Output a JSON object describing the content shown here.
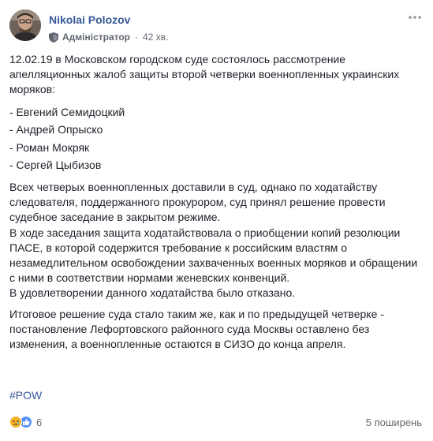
{
  "post": {
    "author_name": "Nikolai Polozov",
    "role": "Адміністратор",
    "time_ago": "42 хв.",
    "paragraphs": [
      "12.02.19 в Московском городском суде состоялось рассмотрение апелляционных жалоб защиты второй четверки военнопленных украинских моряков:"
    ],
    "list": [
      "- Евгений Семидоцкий",
      "- Андрей Опрыско",
      "- Роман Мокряк",
      "- Сергей Цыбизов"
    ],
    "paragraph_2": "Всех четверых военнопленных доставили в суд, однако по ходатайству следователя, поддержанного прокурором, суд принял решение провести судебное заседание в закрытом режиме.",
    "paragraph_3": "В ходе заседания защита ходатайствовала о приобщении копий резолюции ПАСЕ, в которой содержится требование к российским властям о незамедлительном освобождении захваченных военных моряков и обращении с ними в соответствии нормами женевских конвенций.",
    "paragraph_4": "В удовлетворении данного ходатайства было отказано.",
    "paragraph_5": "Итоговое решение суда стало таким же, как и по предыдущей четверке - постановление Лефортовского районного суда Москвы оставлено без изменения, а военнопленные остаются в СИЗО до конца апреля.",
    "hashtag": "#POW",
    "reaction_count": "6",
    "shares": "5 поширень"
  },
  "colors": {
    "link_blue": "#385898",
    "text": "#1d2129",
    "meta_gray": "#616770",
    "like_blue": "#5890ff",
    "sad_yellow": "#f7b125"
  },
  "icons": {
    "avatar": "avatar-photo",
    "shield": "admin-shield-icon",
    "more": "more-options-icon",
    "sad": "sad-reaction-icon",
    "like": "like-reaction-icon"
  }
}
